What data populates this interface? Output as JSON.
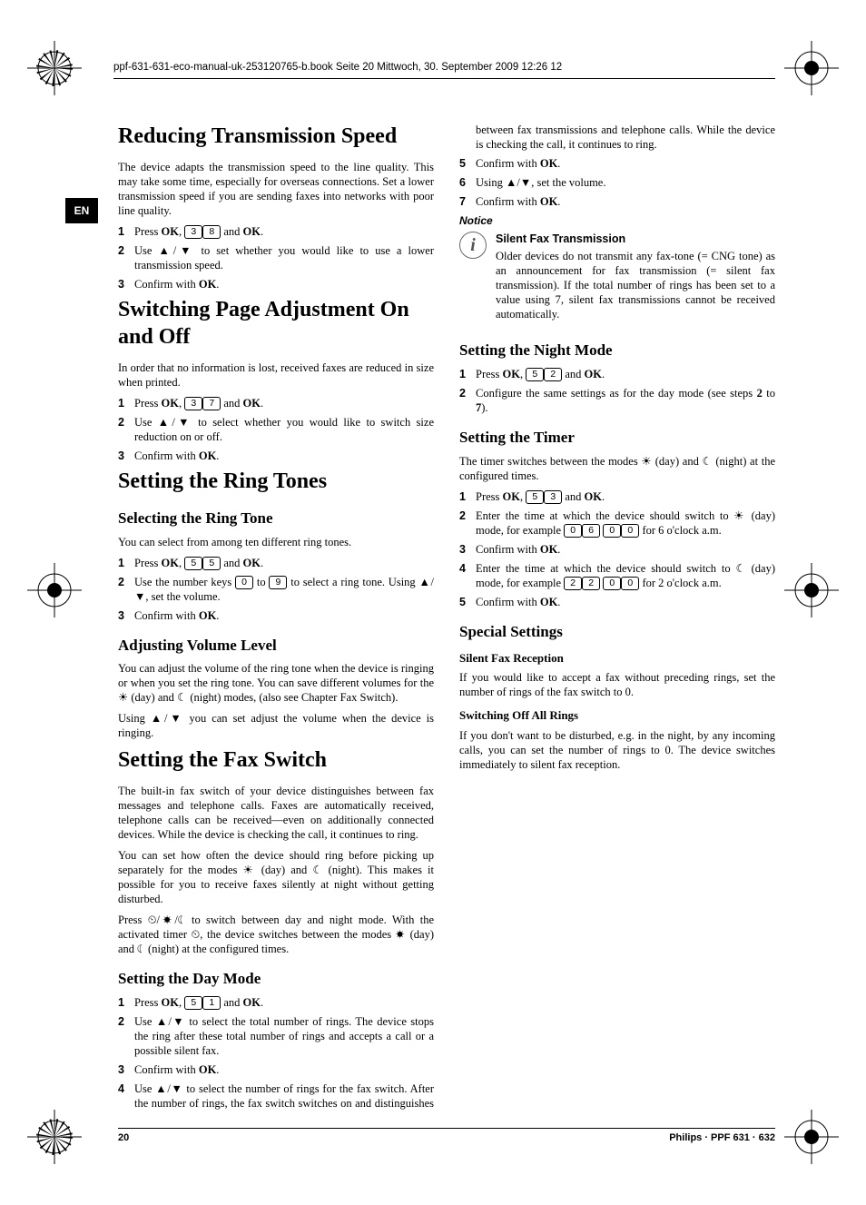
{
  "header": "ppf-631-631-eco-manual-uk-253120765-b.book  Seite 20  Mittwoch, 30. September 2009  12:26 12",
  "lang": "EN",
  "footer": {
    "page": "20",
    "product": "Philips · PPF 631 · 632"
  },
  "s1": {
    "h": "Reducing Transmission Speed",
    "p1": "The device adapts the transmission speed to the line quality. This may take some time, especially for overseas connections. Set a lower transmission speed if you are sending faxes into networks with poor line quality.",
    "st1a": "Press ",
    "st1b": ", ",
    "st1c": " and ",
    "st1d": ".",
    "st2": "Use ▲/▼ to set whether you would like to use a lower transmission speed.",
    "st3": "Confirm with "
  },
  "s2": {
    "h": "Switching Page Adjustment On and Off",
    "p1": "In order that no information is lost, received faxes are reduced in size when printed.",
    "st2": "Use ▲/▼ to select whether you would like to switch size reduction on or off.",
    "st3": "Confirm with "
  },
  "s3": {
    "h": "Setting the Ring Tones",
    "sub1": "Selecting the Ring Tone",
    "p1": "You can select from among ten different ring tones.",
    "st2": "Use the number keys ",
    "st2b": " to ",
    "st2c": " to select a ring tone. Using ▲/▼, set the volume.",
    "st3": "Confirm with ",
    "sub2": "Adjusting Volume Level",
    "p2": "You can adjust the volume of the ring tone when the device is ringing or when you set the ring tone. You can save different volumes for the ☀ (day) and ☾ (night) modes, (also see Chapter Fax Switch).",
    "p3": "Using ▲/▼ you can set adjust the volume when the device is ringing."
  },
  "s4": {
    "h": "Setting the Fax Switch",
    "p1": "The built-in fax switch of your device distinguishes between fax messages and telephone calls. Faxes are automatically received, telephone calls can be received—even on additionally connected devices. While the device is checking the call, it continues to ring.",
    "p2": "You can set how often the device should ring before picking up separately for the modes ☀ (day) and ☾ (night). This makes it possible for you to receive faxes silently at night without getting disturbed.",
    "p3": "Press ⏲/☀/☾ to switch between day and night mode. With the activated timer ⏲, the device switches between the modes ☀ (day) and ☾ (night) at the configured times."
  },
  "s5": {
    "h": "Setting the Day Mode",
    "st2": "Use ▲/▼ to select the total number of rings. The device stops the ring after these total number of rings and accepts a call or a possible silent fax.",
    "st3": "Confirm with ",
    "st4": "Use ▲/▼ to select the number of rings for the fax switch. After the number of rings, the fax switch switches on and distinguishes between fax transmissions and telephone calls. While the device is checking the call, it continues to ring.",
    "st5": "Confirm with ",
    "st6": "Using ▲/▼, set the volume.",
    "st7": "Confirm with ",
    "noticeLabel": "Notice",
    "noticeTitle": "Silent Fax Transmission",
    "noticeBody": "Older devices do not transmit any fax-tone (= CNG tone) as an announcement for fax transmission (= silent fax transmission). If the total number of rings has been set to a value using 7, silent fax transmissions cannot be received automatically."
  },
  "s6": {
    "h": "Setting the Night Mode",
    "st2": "Configure the same settings as for the day mode (see steps ",
    "st2b": " to ",
    "st2c": ")."
  },
  "s7": {
    "h": "Setting the Timer",
    "p1": "The timer switches between the modes ☀ (day) and ☾ (night) at the configured times.",
    "st2": "Enter the time at which the device should switch to ☀ (day) mode, for example ",
    "st2b": " for 6 o'clock a.m.",
    "st3": "Confirm with ",
    "st4": "Enter the time at which the device should switch to ☾ (day) mode, for example ",
    "st4b": " for 2 o'clock a.m.",
    "st5": "Confirm with "
  },
  "s8": {
    "h": "Special Settings",
    "sub1": "Silent Fax Reception",
    "p1": "If you would like to accept a fax without preceding rings, set the number of rings of the fax switch to 0.",
    "sub2": "Switching Off All Rings",
    "p2": "If you don't want to be disturbed, e.g. in the night, by any incoming calls, you can set the number of rings to 0. The device switches immediately to silent fax reception."
  },
  "labels": {
    "ok": "OK",
    "n1": "1",
    "n2": "2",
    "n3": "3",
    "n4": "4",
    "n5": "5",
    "n6": "6",
    "n7": "7"
  }
}
